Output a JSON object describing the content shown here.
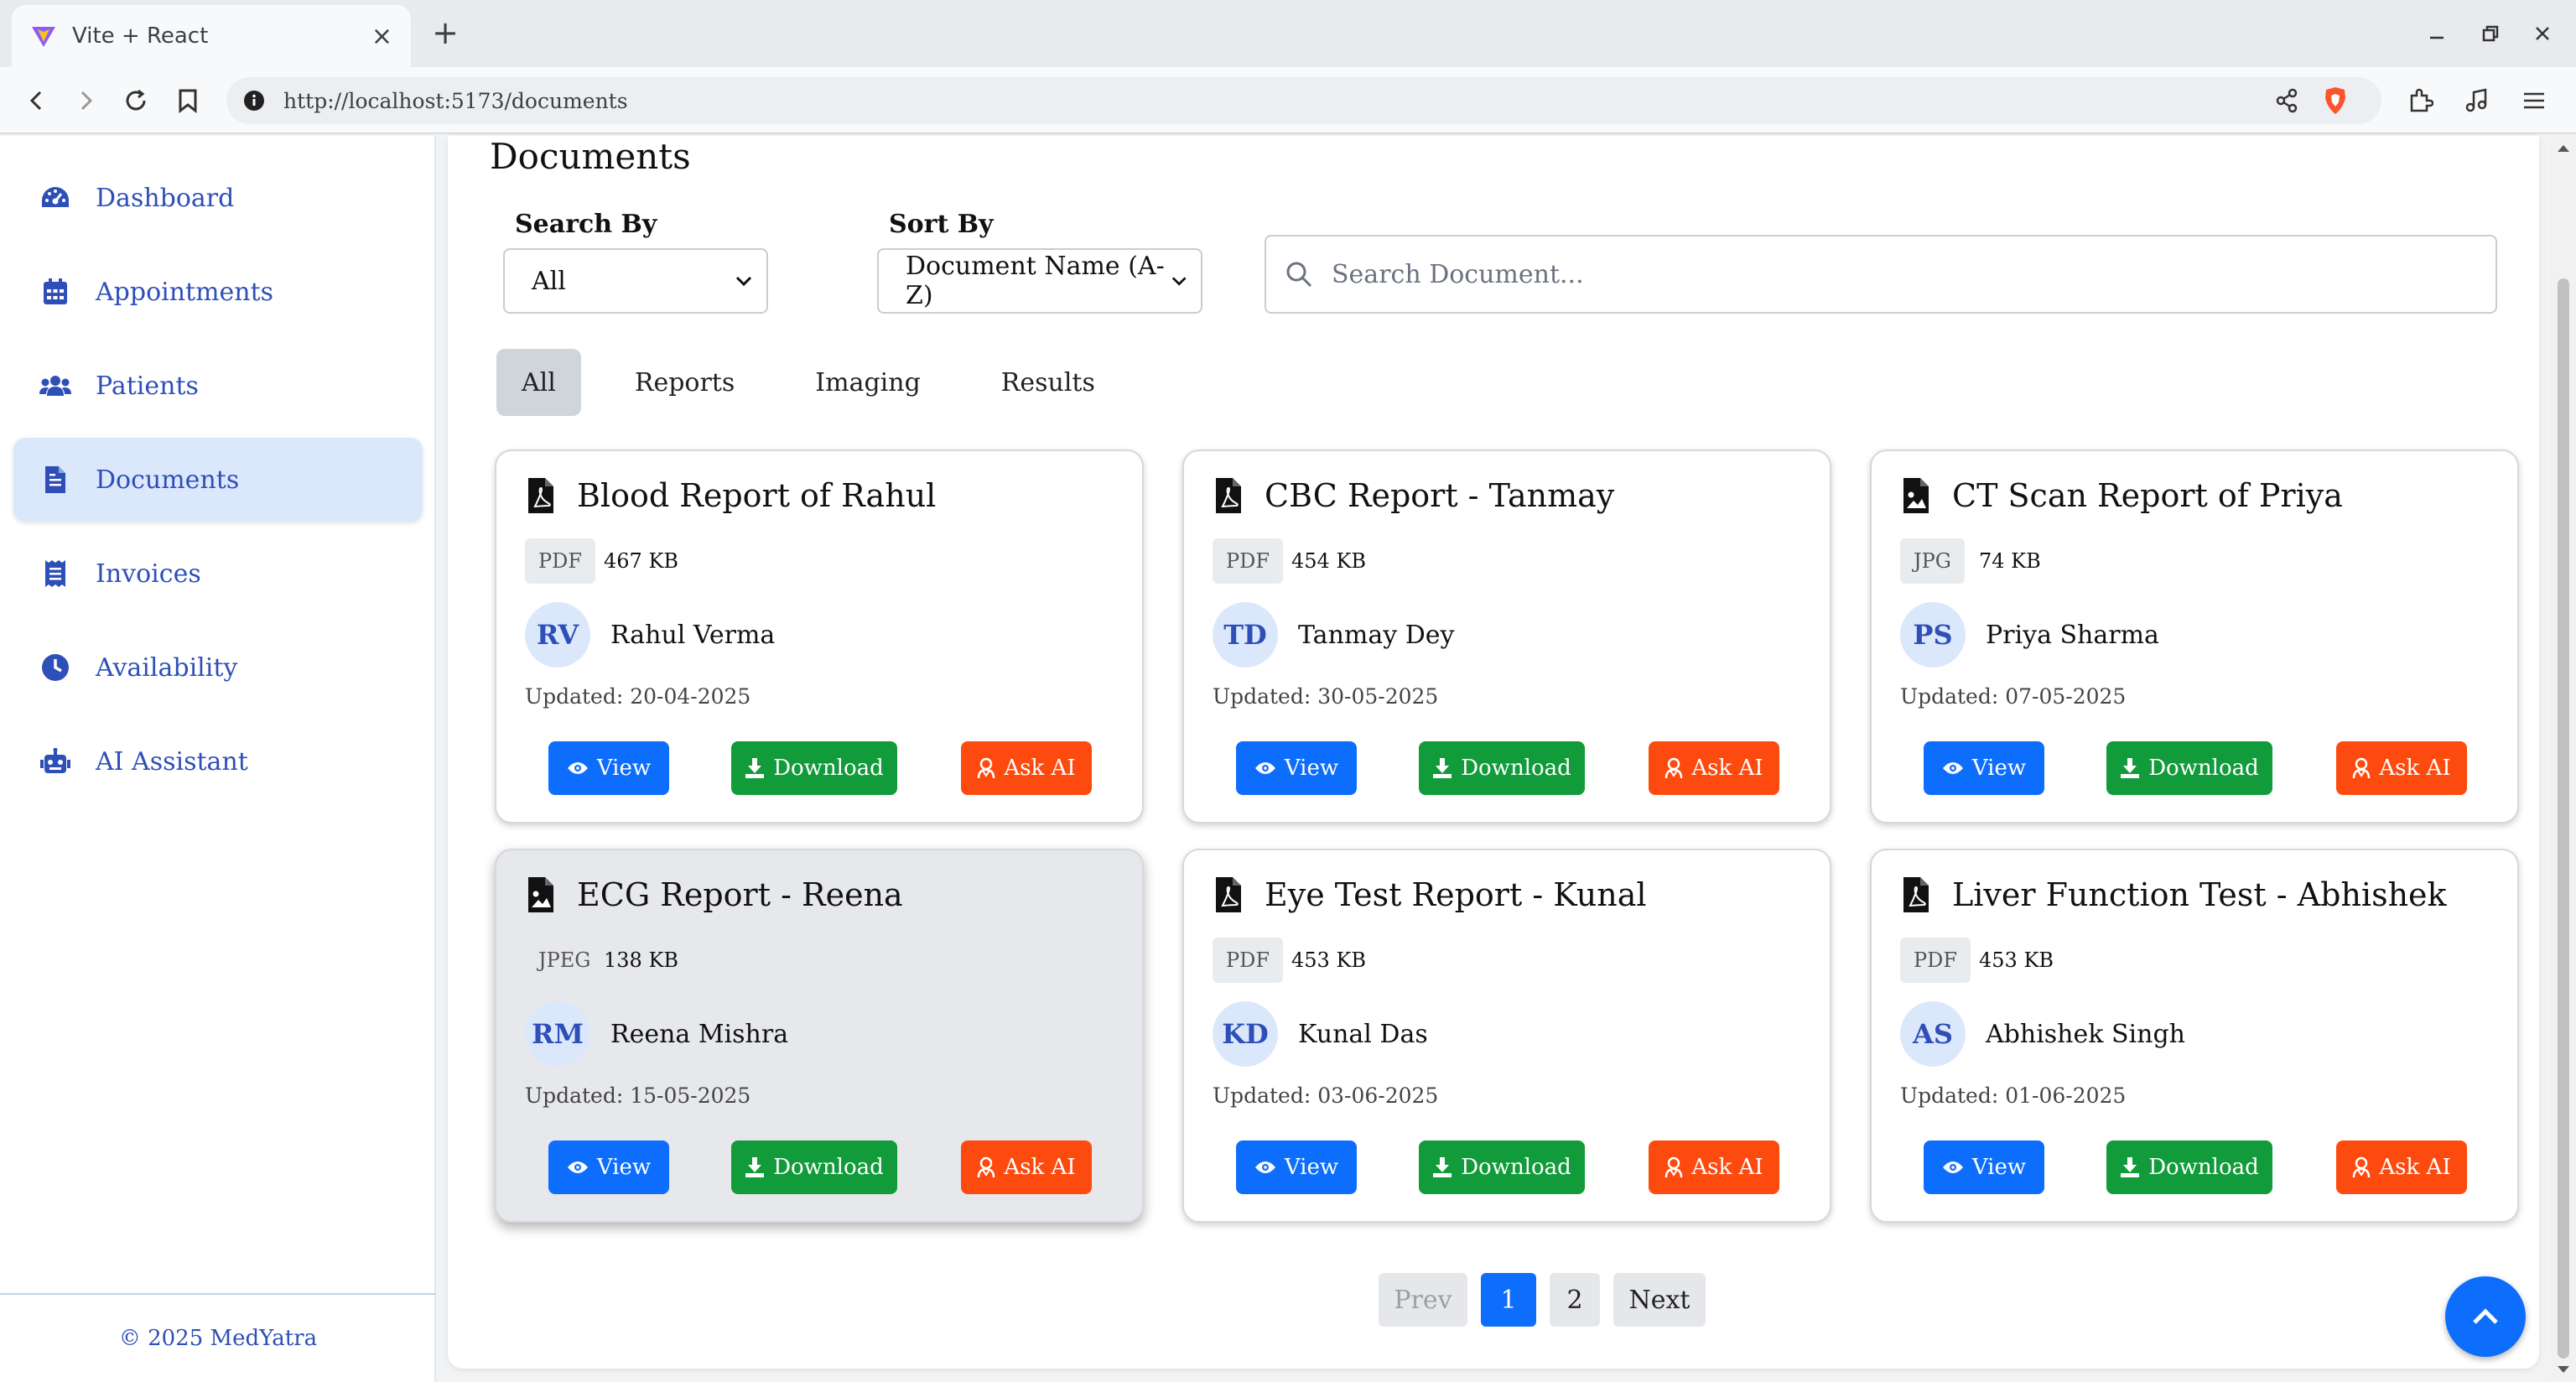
{
  "browser": {
    "tab_title": "Vite + React",
    "url": "http://localhost:5173/documents"
  },
  "sidebar": {
    "items": [
      {
        "label": "Dashboard",
        "icon": "gauge-icon"
      },
      {
        "label": "Appointments",
        "icon": "calendar-icon"
      },
      {
        "label": "Patients",
        "icon": "users-icon"
      },
      {
        "label": "Documents",
        "icon": "file-icon",
        "active": true
      },
      {
        "label": "Invoices",
        "icon": "receipt-icon"
      },
      {
        "label": "Availability",
        "icon": "clock-icon"
      },
      {
        "label": "AI Assistant",
        "icon": "robot-icon"
      }
    ],
    "footer": "© 2025 MedYatra"
  },
  "page": {
    "title": "Documents",
    "search_by_label": "Search By",
    "search_by_value": "All",
    "sort_by_label": "Sort By",
    "sort_by_value": "Document Name (A-Z)",
    "search_placeholder": "Search Document...",
    "tabs": [
      "All",
      "Reports",
      "Imaging",
      "Results"
    ],
    "active_tab": "All"
  },
  "documents": [
    {
      "title": "Blood Report of Rahul",
      "type": "PDF",
      "size": "467 KB",
      "initials": "RV",
      "patient": "Rahul Verma",
      "updated": "Updated: 20-04-2025",
      "icon": "pdf-file-icon"
    },
    {
      "title": "CBC Report - Tanmay",
      "type": "PDF",
      "size": "454 KB",
      "initials": "TD",
      "patient": "Tanmay Dey",
      "updated": "Updated: 30-05-2025",
      "icon": "pdf-file-icon"
    },
    {
      "title": "CT Scan Report of Priya",
      "type": "JPG",
      "size": "74 KB",
      "initials": "PS",
      "patient": "Priya Sharma",
      "updated": "Updated: 07-05-2025",
      "icon": "image-file-icon"
    },
    {
      "title": "ECG Report - Reena",
      "type": "JPEG",
      "size": "138 KB",
      "initials": "RM",
      "patient": "Reena Mishra",
      "updated": "Updated: 15-05-2025",
      "icon": "image-file-icon"
    },
    {
      "title": "Eye Test Report - Kunal",
      "type": "PDF",
      "size": "453 KB",
      "initials": "KD",
      "patient": "Kunal Das",
      "updated": "Updated: 03-06-2025",
      "icon": "pdf-file-icon"
    },
    {
      "title": "Liver Function Test - Abhishek",
      "type": "PDF",
      "size": "453 KB",
      "initials": "AS",
      "patient": "Abhishek Singh",
      "updated": "Updated: 01-06-2025",
      "icon": "pdf-file-icon"
    }
  ],
  "buttons": {
    "view": "View",
    "download": "Download",
    "ask_ai": "Ask AI"
  },
  "pagination": {
    "prev": "Prev",
    "pages": [
      "1",
      "2"
    ],
    "current": "1",
    "next": "Next"
  },
  "colors": {
    "primary": "#0d6efd",
    "success": "#129b3a",
    "danger": "#fd4b0f",
    "sidebar_text": "#2f4fb8",
    "active_bg": "#dbe8fc"
  }
}
